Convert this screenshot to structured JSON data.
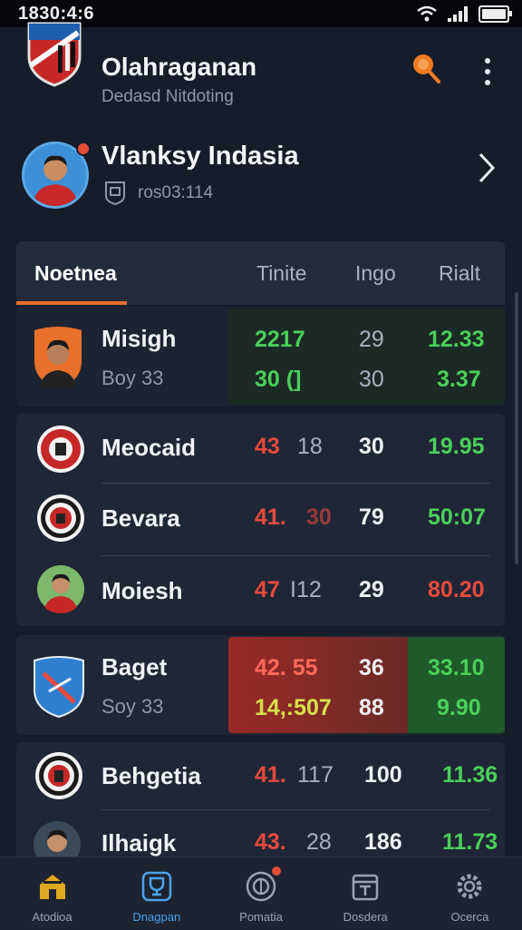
{
  "status": {
    "time": "1830:4:6"
  },
  "header": {
    "title": "Olahraganan",
    "subtitle": "Dedasd Nitdoting"
  },
  "profile": {
    "name": "Vlanksy Indasia",
    "id": "ros03:114"
  },
  "table": {
    "tabs": [
      "Noetnea",
      "Tinite",
      "Ingo",
      "Rialt"
    ],
    "rows": [
      {
        "name": "Misigh",
        "sub": "Boy 33",
        "v1": "2217",
        "v2": "29",
        "v3": "12.33",
        "v1b": "30 (]",
        "v2b": "30",
        "v3b": "3.37"
      },
      {
        "name": "Meocaid",
        "v1": "43",
        "v1x": "18",
        "v2": "30",
        "v3": "19.95"
      },
      {
        "name": "Bevara",
        "v1": "41.",
        "v1x": "30",
        "v2": "79",
        "v3": "50:07"
      },
      {
        "name": "Moiesh",
        "v1": "47",
        "v1x": "I12",
        "v2": "29",
        "v3": "80.20"
      },
      {
        "name": "Baget",
        "sub": "Soy 33",
        "v1": "42. 55",
        "v2": "36",
        "v3": "33.10",
        "v1b": "14,:507",
        "v2b": "88",
        "v3b": "9.90"
      },
      {
        "name": "Behgetia",
        "v1": "41.",
        "v1x": "117",
        "v2": "100",
        "v3": "11.36"
      },
      {
        "name": "Ilhaigk",
        "v1": "43.",
        "v1x": "28",
        "v2": "186",
        "v3": "11.73"
      }
    ]
  },
  "nav": [
    {
      "label": "Atodioa",
      "icon": "home-icon"
    },
    {
      "label": "Dnagpan",
      "icon": "trophy-icon"
    },
    {
      "label": "Pomatia",
      "icon": "ball-icon"
    },
    {
      "label": "Dosdera",
      "icon": "calendar-icon"
    },
    {
      "label": "Ocerca",
      "icon": "gear-icon"
    }
  ]
}
